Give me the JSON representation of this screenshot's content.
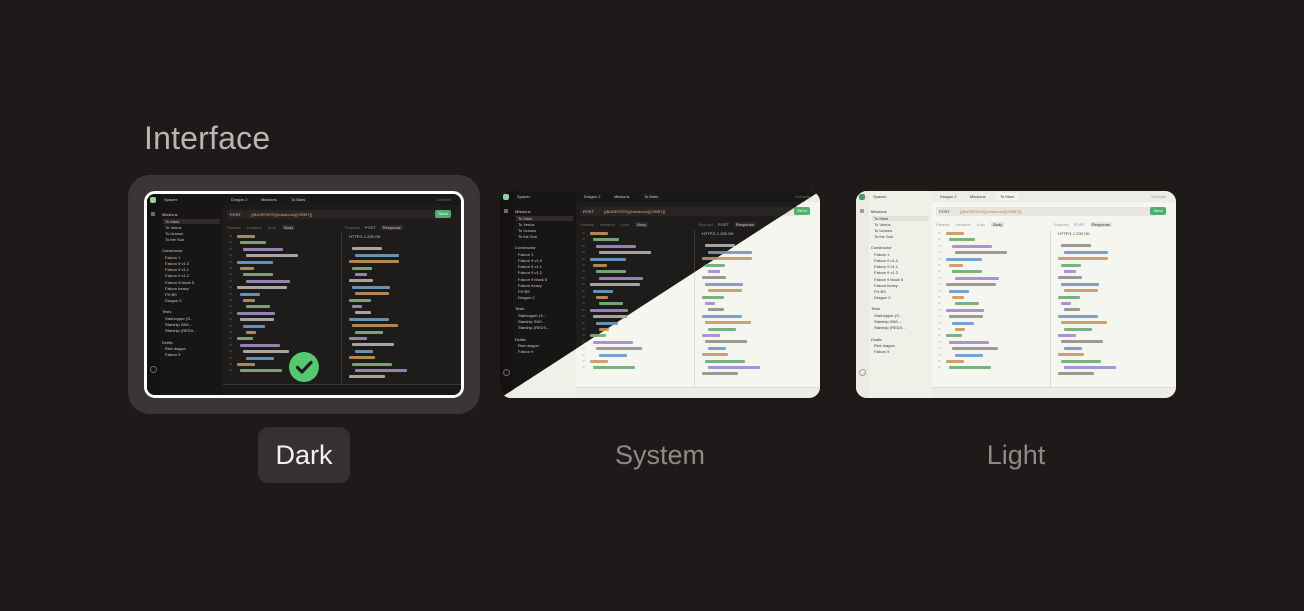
{
  "section": {
    "title": "Interface"
  },
  "themes": [
    {
      "id": "dark",
      "label": "Dark",
      "selected": true
    },
    {
      "id": "system",
      "label": "System",
      "selected": false
    },
    {
      "id": "light",
      "label": "Light",
      "selected": false
    }
  ],
  "preview": {
    "workspace": "Spacex",
    "tabs": [
      "Dragon 2",
      "Missions",
      "To Mars"
    ],
    "environment": "Defaults",
    "method": "POST",
    "url": "{{BASEPATH}}/missions/{{ORBIT}}",
    "send_label": "Send",
    "request_tabs": [
      "Params",
      "Headers",
      "Auth",
      "Body"
    ],
    "response_tabs": [
      "Request",
      "POST",
      "Response"
    ],
    "response_status": "HTTP/1.1 200 OK",
    "sidebar_groups": [
      {
        "name": "Missions",
        "items": [
          "To Mars",
          "To Venus",
          "To Uranus",
          "To the Sun"
        ]
      },
      {
        "name": "Constructor",
        "items": [
          "Falcon 1",
          "Falcon 9 v1.0",
          "Falcon 9 v1.1",
          "Falcon 9 v1.2",
          "Falcon 9 block 5",
          "Falcon heavy",
          "FH BS",
          "Dragon 2"
        ]
      },
      {
        "name": "Tests",
        "items": [
          "Starhopper (S...",
          "Starship SN9...",
          "Starship (REDX..."
        ]
      },
      {
        "name": "Drafts",
        "items": [
          "Red dragon",
          "Falcon 9"
        ]
      }
    ]
  },
  "colors": {
    "page_bg": "#1d1a19",
    "dark_bg": "#1e1c1b",
    "light_bg": "#f6f6f0",
    "accent_green": "#4eaf6e",
    "check_green": "#55c870"
  }
}
